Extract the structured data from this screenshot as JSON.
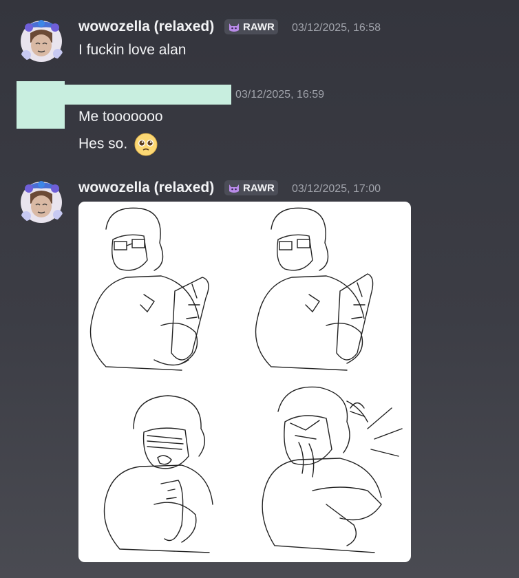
{
  "messages": [
    {
      "author": "wowozella (relaxed)",
      "tag": "RAWR",
      "timestamp": "03/12/2025, 16:58",
      "lines": [
        "I fuckin love alan"
      ]
    },
    {
      "author": "",
      "timestamp": "03/12/2025, 16:59",
      "lines": [
        "Me tooooooo",
        "Hes so."
      ],
      "emoji": "pleading-face"
    },
    {
      "author": "wowozella (relaxed)",
      "tag": "RAWR",
      "timestamp": "03/12/2025, 17:00",
      "attachment": {
        "type": "image",
        "description_icon": "sketch-comic-4-panel"
      }
    }
  ],
  "colors": {
    "background_top": "#34353d",
    "background_bottom": "#4a4b52",
    "text": "#f2f3f5",
    "muted": "#a0a3ab",
    "redaction": "#c8eedf",
    "tag_bg": "#4b4d57"
  }
}
